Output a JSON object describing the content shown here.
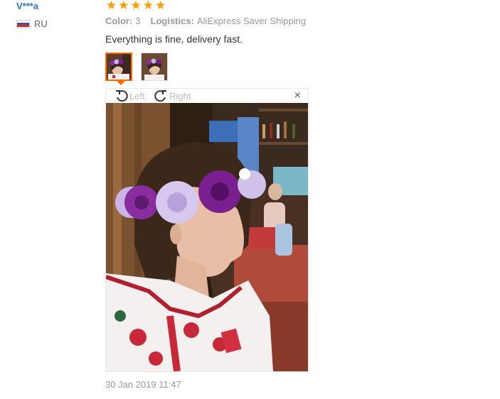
{
  "review": {
    "user": "V***a",
    "country": "RU",
    "rating": 5,
    "color_label": "Color:",
    "color_value": "3",
    "logistics_label": "Logistics:",
    "logistics_value": "AliExpress Saver Shipping",
    "text": "Everything is fine, delivery fast.",
    "date": "30 Jan 2019 11:47"
  },
  "viewer": {
    "rotate_left": "Left",
    "rotate_right": "Right",
    "close": "×"
  },
  "icons": {
    "star": "★",
    "flag": "russia-flag-icon"
  },
  "colors": {
    "username": "#3276c3",
    "star": "#ff9a00",
    "accent": "#ff6a00"
  }
}
